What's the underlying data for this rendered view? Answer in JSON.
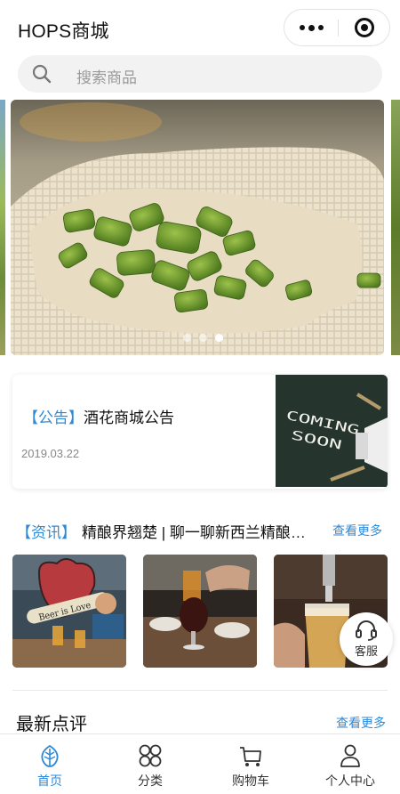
{
  "header": {
    "title": "HOPS商城"
  },
  "search": {
    "placeholder": "搜索商品"
  },
  "banner": {
    "slide_count": 3,
    "active_index": 2
  },
  "notice": {
    "tag": "【公告】",
    "title": "酒花商城公告",
    "date": "2019.03.22",
    "image_text": "COMING SOON"
  },
  "news": {
    "tag": "【资讯】",
    "title": "精酿界翘楚 | 聊一聊新西兰精酿…",
    "more": "查看更多",
    "image_text": "Beer is Love"
  },
  "service": {
    "label": "客服"
  },
  "reviews": {
    "heading": "最新点评",
    "more": "查看更多"
  },
  "tabs": [
    {
      "label": "首页",
      "icon": "leaf-icon",
      "active": true
    },
    {
      "label": "分类",
      "icon": "grid-icon",
      "active": false
    },
    {
      "label": "购物车",
      "icon": "cart-icon",
      "active": false
    },
    {
      "label": "个人中心",
      "icon": "user-icon",
      "active": false
    }
  ],
  "colors": {
    "accent": "#2d8ad8",
    "text": "#111111",
    "muted": "#888888"
  }
}
